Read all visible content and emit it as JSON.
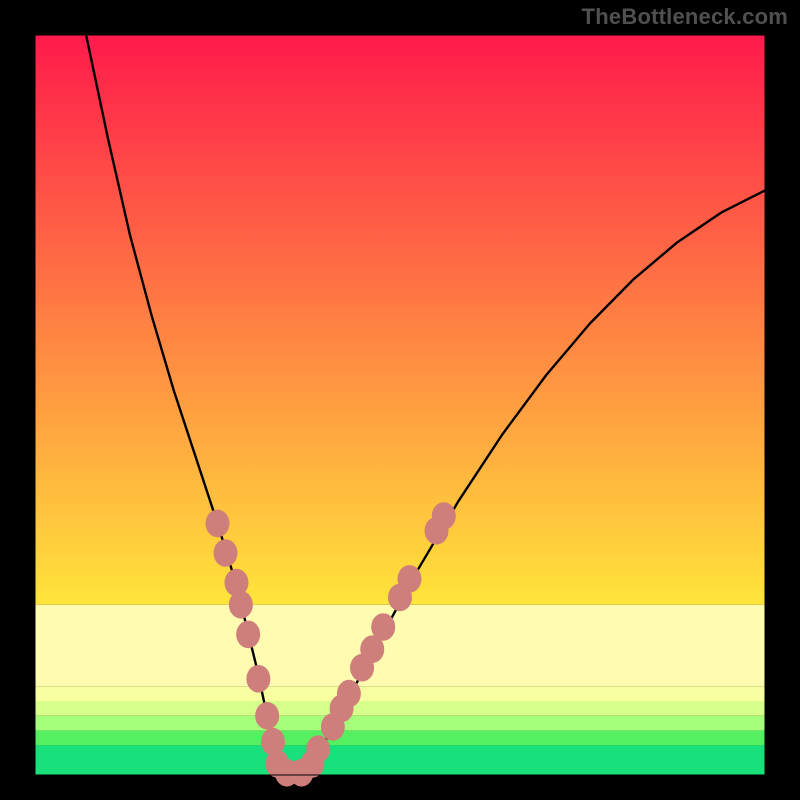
{
  "watermark": {
    "text": "TheBottleneck.com"
  },
  "chart_data": {
    "type": "line",
    "title": "",
    "xlabel": "",
    "ylabel": "",
    "xlim": [
      0,
      100
    ],
    "ylim": [
      0,
      100
    ],
    "grid": false,
    "legend_position": "none",
    "bands": [
      {
        "y0": 0,
        "y1": 77,
        "gradient": [
          "#ff1a4b",
          "#ffe53b"
        ]
      },
      {
        "y0": 77,
        "y1": 88,
        "color": "#fffbb0"
      },
      {
        "y0": 88,
        "y1": 90,
        "color": "#f7ffa0"
      },
      {
        "y0": 90,
        "y1": 92,
        "color": "#d7ff8c"
      },
      {
        "y0": 92,
        "y1": 94,
        "color": "#a6ff7a"
      },
      {
        "y0": 94,
        "y1": 96,
        "color": "#55f060"
      },
      {
        "y0": 96,
        "y1": 100,
        "color": "#18e07a"
      }
    ],
    "series": [
      {
        "name": "bottleneck-curve",
        "color": "#000000",
        "stroke_width": 2.4,
        "x": [
          7,
          10,
          13,
          16,
          19,
          22,
          25,
          27.5,
          29,
          30.5,
          32,
          33,
          34,
          36.5,
          40,
          46,
          52,
          58,
          64,
          70,
          76,
          82,
          88,
          94,
          100
        ],
        "y": [
          0,
          14,
          27,
          38,
          48,
          57,
          66,
          74,
          80,
          86,
          93,
          97,
          99.5,
          99.5,
          95,
          84,
          73,
          63,
          54,
          46,
          39,
          33,
          28,
          24,
          21
        ]
      }
    ],
    "markers": {
      "color": "#cf7f7b",
      "radius": 12,
      "points": [
        {
          "x": 25.0,
          "y": 66
        },
        {
          "x": 26.1,
          "y": 70
        },
        {
          "x": 27.6,
          "y": 74
        },
        {
          "x": 28.2,
          "y": 77
        },
        {
          "x": 29.2,
          "y": 81
        },
        {
          "x": 30.6,
          "y": 87
        },
        {
          "x": 31.8,
          "y": 92
        },
        {
          "x": 32.6,
          "y": 95.5
        },
        {
          "x": 33.2,
          "y": 98.5
        },
        {
          "x": 34.5,
          "y": 99.7
        },
        {
          "x": 36.5,
          "y": 99.7
        },
        {
          "x": 38.0,
          "y": 98.5
        },
        {
          "x": 38.8,
          "y": 96.5
        },
        {
          "x": 40.8,
          "y": 93.5
        },
        {
          "x": 42.0,
          "y": 91
        },
        {
          "x": 43.0,
          "y": 89
        },
        {
          "x": 44.8,
          "y": 85.5
        },
        {
          "x": 46.2,
          "y": 83
        },
        {
          "x": 47.7,
          "y": 80
        },
        {
          "x": 50.0,
          "y": 76
        },
        {
          "x": 51.3,
          "y": 73.5
        },
        {
          "x": 55.0,
          "y": 67
        },
        {
          "x": 56.0,
          "y": 65
        }
      ]
    }
  }
}
